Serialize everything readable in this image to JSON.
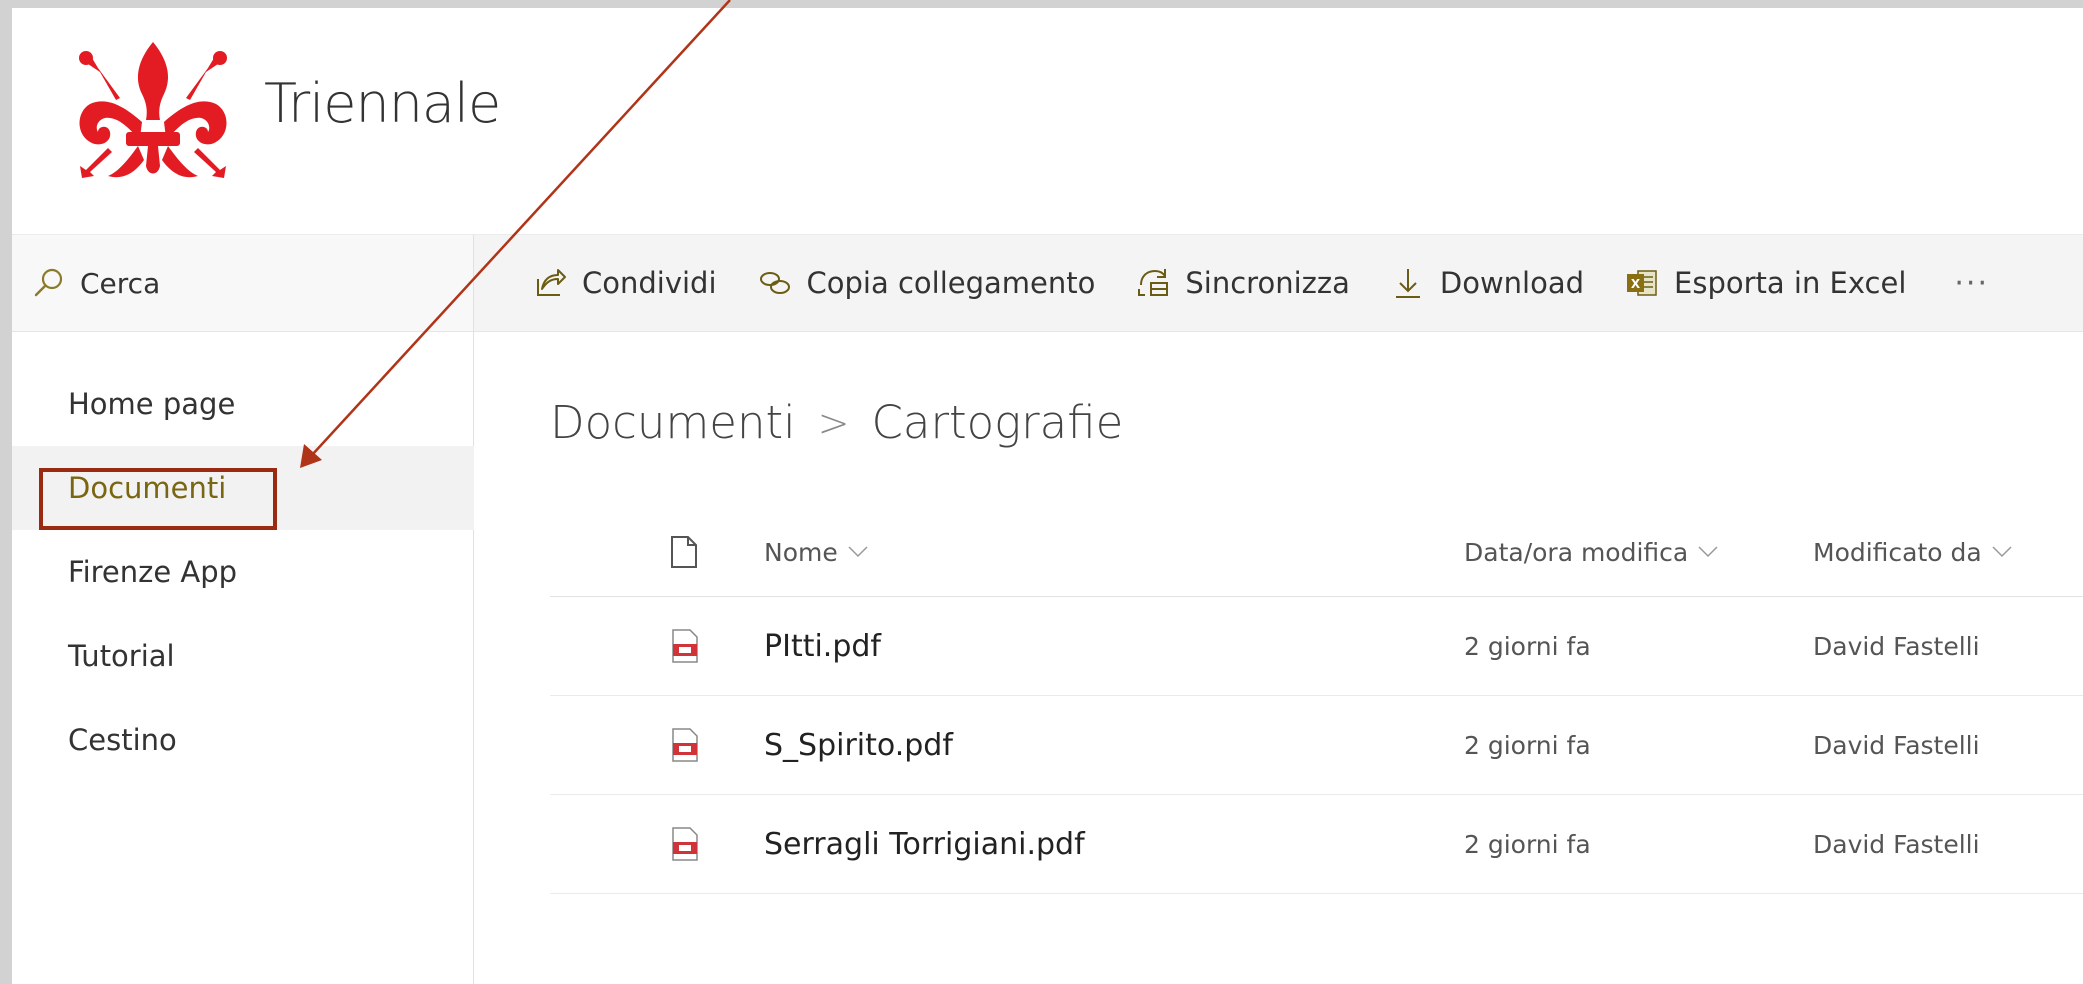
{
  "site": {
    "title": "Triennale",
    "logo_icon": "giglio-fleur-de-lis-logo",
    "logo_color": "#e31b23"
  },
  "search": {
    "label": "Cerca",
    "icon": "search-icon"
  },
  "command_bar": {
    "items": [
      {
        "label": "Condividi",
        "icon": "share-icon"
      },
      {
        "label": "Copia collegamento",
        "icon": "link-icon"
      },
      {
        "label": "Sincronizza",
        "icon": "sync-icon"
      },
      {
        "label": "Download",
        "icon": "download-icon"
      },
      {
        "label": "Esporta in Excel",
        "icon": "excel-icon"
      }
    ],
    "more_label": "···"
  },
  "nav": {
    "items": [
      {
        "label": "Home page",
        "selected": false
      },
      {
        "label": "Documenti",
        "selected": true
      },
      {
        "label": "Firenze App",
        "selected": false
      },
      {
        "label": "Tutorial",
        "selected": false
      },
      {
        "label": "Cestino",
        "selected": false
      }
    ]
  },
  "breadcrumb": {
    "parent": "Documenti",
    "separator": ">",
    "current": "Cartografie"
  },
  "table": {
    "columns": {
      "icon": "file-type-icon",
      "name": "Nome",
      "modified": "Data/ora modifica",
      "modified_by": "Modificato da"
    },
    "rows": [
      {
        "name": "PItti.pdf",
        "modified": "2 giorni fa",
        "modified_by": "David Fastelli",
        "icon": "pdf-file-icon"
      },
      {
        "name": "S_Spirito.pdf",
        "modified": "2 giorni fa",
        "modified_by": "David Fastelli",
        "icon": "pdf-file-icon"
      },
      {
        "name": "Serragli Torrigiani.pdf",
        "modified": "2 giorni fa",
        "modified_by": "David Fastelli",
        "icon": "pdf-file-icon"
      }
    ]
  },
  "colors": {
    "accent_selected": "#7a6511",
    "annotation": "#b03418",
    "pdf_icon": "#d13438"
  }
}
